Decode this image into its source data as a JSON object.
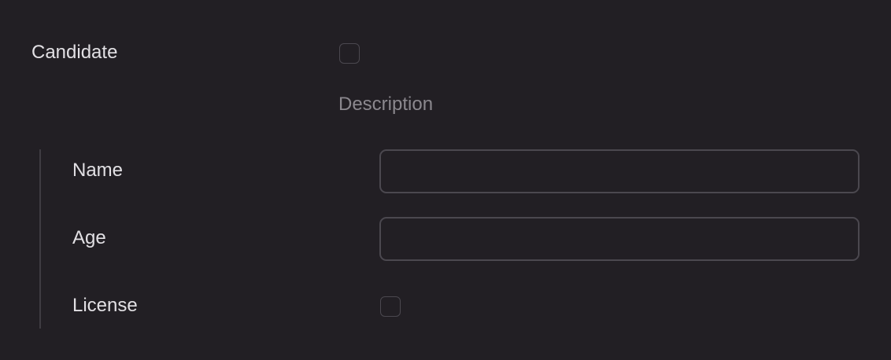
{
  "candidate": {
    "label": "Candidate",
    "checked": false,
    "description": "Description"
  },
  "fields": {
    "name": {
      "label": "Name",
      "value": ""
    },
    "age": {
      "label": "Age",
      "value": ""
    },
    "license": {
      "label": "License",
      "checked": false
    }
  }
}
